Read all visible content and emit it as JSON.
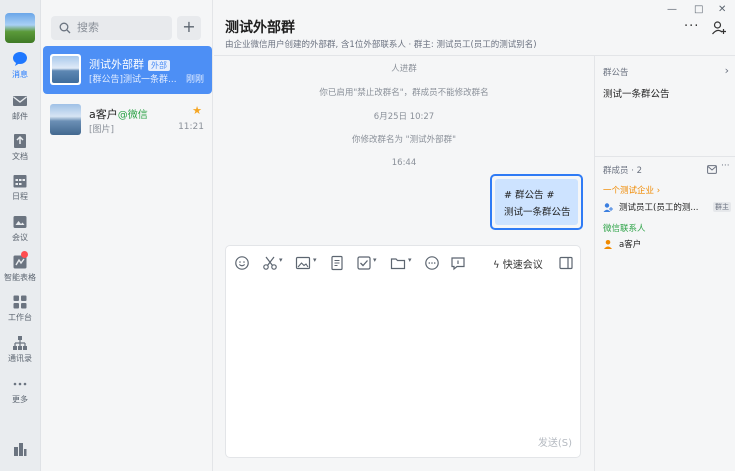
{
  "nav": {
    "items": [
      {
        "label": "消息",
        "icon": "chat-icon",
        "active": true
      },
      {
        "label": "邮件",
        "icon": "mail-icon"
      },
      {
        "label": "文档",
        "icon": "doc-icon"
      },
      {
        "label": "日程",
        "icon": "calendar-icon"
      },
      {
        "label": "会议",
        "icon": "meeting-icon"
      },
      {
        "label": "智能表格",
        "icon": "smart-table-icon"
      },
      {
        "label": "工作台",
        "icon": "workbench-icon"
      },
      {
        "label": "通讯录",
        "icon": "contacts-icon"
      },
      {
        "label": "更多",
        "icon": "more-dots-icon"
      }
    ]
  },
  "search": {
    "placeholder": "搜索"
  },
  "sessions": [
    {
      "name": "测试外部群",
      "tag": "外部",
      "preview": "[群公告]测试一条群...",
      "time": "刚刚",
      "active": true
    },
    {
      "name": "a客户",
      "tag": "@微信",
      "preview": "[图片]",
      "time": "11:21",
      "starred": true
    }
  ],
  "chat": {
    "title": "测试外部群",
    "subtitle": "由企业微信用户创建的外部群, 含1位外部联系人 · 群主: 测试员工(员工的测试别名)",
    "system_messages": [
      "人进群",
      "你已启用\"禁止改群名\"，群成员不能修改群名",
      "6月25日 10:27",
      "你修改群名为 \"测试外部群\"",
      "16:44"
    ],
    "bubble_line1": "# 群公告 #",
    "bubble_line2": "测试一条群公告",
    "toolbar": {
      "quick_meeting": "快速会议",
      "send": "发送(S)"
    }
  },
  "right_panel": {
    "announcement_label": "群公告",
    "announcement_text": "测试一条群公告",
    "members_label": "群成员 · 2",
    "company_group": "一个测试企业 ›",
    "member1": "测试员工(员工的测...",
    "member1_role": "群主",
    "wechat_group": "微信联系人",
    "member2": "a客户"
  },
  "colors": {
    "accent": "#1f78ff",
    "active_session": "#4d8ff5",
    "wechat_green": "#2ba245",
    "company_orange": "#f08a00",
    "bubble": "#cde3ff"
  }
}
